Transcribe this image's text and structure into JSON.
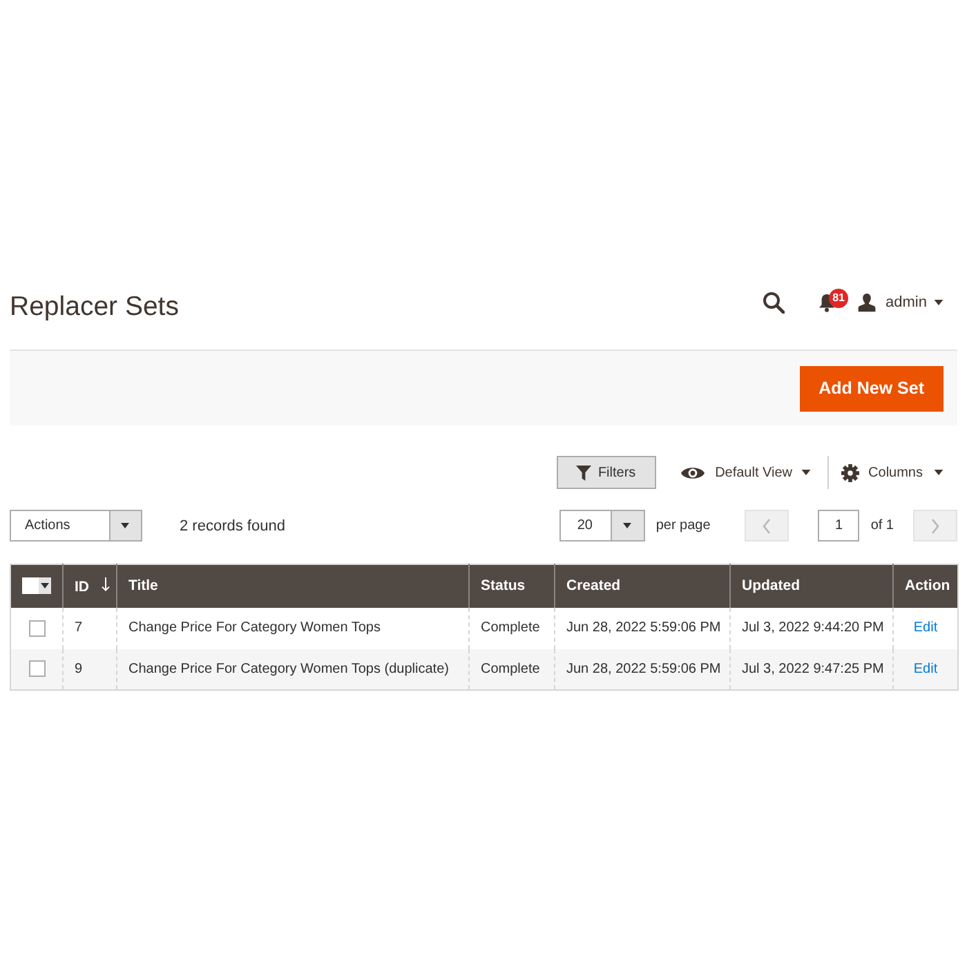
{
  "page": {
    "title": "Replacer Sets"
  },
  "header": {
    "notifications": {
      "count": "81"
    },
    "user": {
      "name": "admin"
    }
  },
  "page_actions": {
    "buttons": [
      "Add New Set"
    ]
  },
  "toolbar": {
    "filters": {
      "label": "Filters"
    },
    "view": {
      "label": "Default View"
    },
    "columns": {
      "label": "Columns"
    }
  },
  "mass_actions": {
    "label": "Actions"
  },
  "records_found": "2 records found",
  "pagination": {
    "page_size": "20",
    "per_page_label": "per page",
    "previous": {
      "disabled": true
    },
    "current_page": "1",
    "page_count": "of 1",
    "next": {
      "disabled": true
    }
  },
  "table": {
    "select_all": {
      "checked": false
    },
    "columns": [
      {
        "label": "ID",
        "sorted": true
      },
      {
        "label": "Title",
        "sorted": false
      },
      {
        "label": "Status",
        "sorted": false
      },
      {
        "label": "Created",
        "sorted": false
      },
      {
        "label": "Updated",
        "sorted": false
      },
      {
        "label": "Action",
        "sorted": false
      }
    ],
    "rows": [
      {
        "checked": false,
        "cells": [
          "7",
          "Change Price For Category Women Tops",
          "Complete",
          "Jun 28, 2022 5:59:06 PM",
          "Jul 3, 2022 9:44:20 PM"
        ],
        "action": "Edit"
      },
      {
        "checked": false,
        "cells": [
          "9",
          "Change Price For Category Women Tops (duplicate)",
          "Complete",
          "Jun 28, 2022 5:59:06 PM",
          "Jul 3, 2022 9:47:25 PM"
        ],
        "action": "Edit"
      }
    ]
  }
}
